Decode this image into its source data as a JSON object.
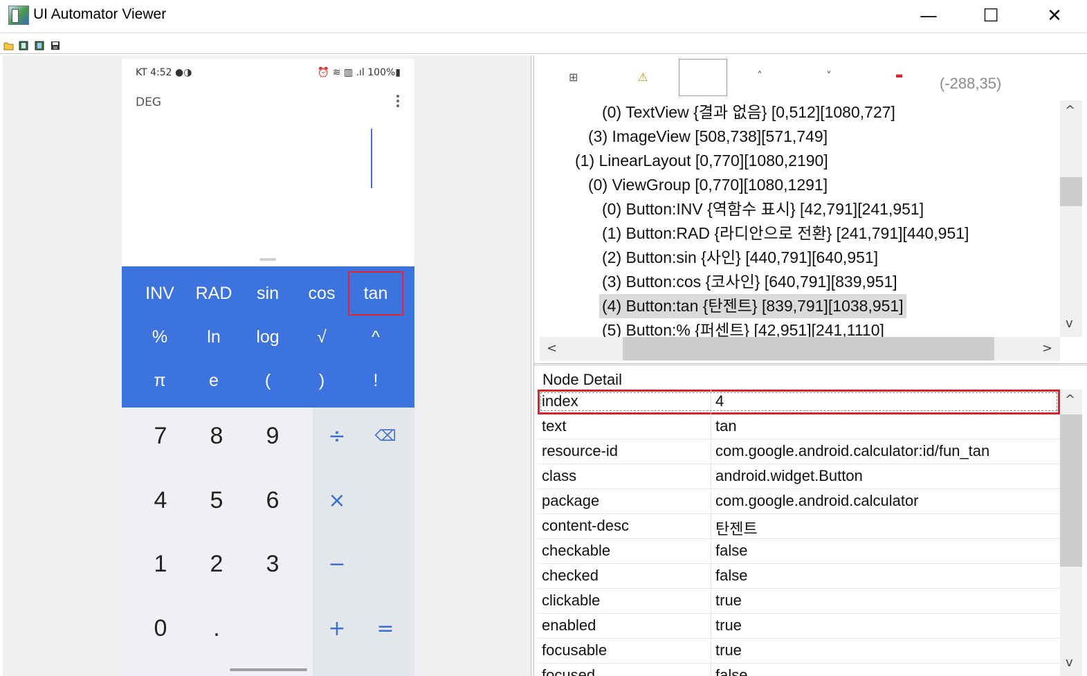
{
  "window": {
    "title": "UI Automator Viewer",
    "minimize_glyph": "—",
    "maximize_glyph": "☐",
    "close_glyph": "✕"
  },
  "toolbar": {
    "icons": [
      "open-folder-icon",
      "device-screenshot-icon",
      "device-screenshot-compressed-icon",
      "save-icon"
    ]
  },
  "phone": {
    "status_left": "KT 4:52 ●◑",
    "status_right": "⏰ ≋ ▥ .ıl 100%▮",
    "mode": "DEG",
    "sci_keys": [
      {
        "label": "INV"
      },
      {
        "label": "RAD"
      },
      {
        "label": "sin"
      },
      {
        "label": "cos"
      },
      {
        "label": "tan"
      },
      {
        "label": "%"
      },
      {
        "label": "ln"
      },
      {
        "label": "log"
      },
      {
        "label": "√"
      },
      {
        "label": "^"
      },
      {
        "label": "π"
      },
      {
        "label": "e"
      },
      {
        "label": "("
      },
      {
        "label": ")"
      },
      {
        "label": "!"
      }
    ],
    "num_keys": [
      {
        "label": "7"
      },
      {
        "label": "8"
      },
      {
        "label": "9"
      },
      {
        "label": "4"
      },
      {
        "label": "5"
      },
      {
        "label": "6"
      },
      {
        "label": "1"
      },
      {
        "label": "2"
      },
      {
        "label": "3"
      },
      {
        "label": "0"
      },
      {
        "label": "."
      }
    ],
    "op_keys": [
      {
        "label": "÷"
      },
      {
        "label": "⌫"
      },
      {
        "label": "×"
      },
      {
        "label": "−"
      },
      {
        "label": "+"
      },
      {
        "label": "="
      }
    ],
    "highlight_color": "#e8232b",
    "pad_color": "#3c73df"
  },
  "tree_toolbar": {
    "expand_glyph": "⊞",
    "warning_glyph": "⚠",
    "up_glyph": "˄",
    "down_glyph": "˅",
    "remove_glyph": "▬",
    "coords": "(-288,35)"
  },
  "tree": {
    "rows": [
      "(0) TextView {결과 없음} [0,512][1080,727]",
      "(3) ImageView [508,738][571,749]",
      "(1) LinearLayout [0,770][1080,2190]",
      "(0) ViewGroup [0,770][1080,1291]",
      "(0) Button:INV {역함수 표시} [42,791][241,951]",
      "(1) Button:RAD {라디안으로 전환} [241,791][440,951]",
      "(2) Button:sin {사인} [440,791][640,951]",
      "(3) Button:cos {코사인} [640,791][839,951]",
      "(4) Button:tan {탄젠트} [839,791][1038,951]",
      "(5) Button:% {퍼센트} [42,951][241,1110]"
    ],
    "scroll_left": "<",
    "scroll_right": ">",
    "scroll_up": "^",
    "scroll_down": "v"
  },
  "node_detail": {
    "title": "Node Detail",
    "rows": [
      {
        "key": "index",
        "value": "4"
      },
      {
        "key": "text",
        "value": "tan"
      },
      {
        "key": "resource-id",
        "value": "com.google.android.calculator:id/fun_tan"
      },
      {
        "key": "class",
        "value": "android.widget.Button"
      },
      {
        "key": "package",
        "value": "com.google.android.calculator"
      },
      {
        "key": "content-desc",
        "value": "탄젠트"
      },
      {
        "key": "checkable",
        "value": "false"
      },
      {
        "key": "checked",
        "value": "false"
      },
      {
        "key": "clickable",
        "value": "true"
      },
      {
        "key": "enabled",
        "value": "true"
      },
      {
        "key": "focusable",
        "value": "true"
      },
      {
        "key": "focused",
        "value": "false"
      }
    ]
  }
}
